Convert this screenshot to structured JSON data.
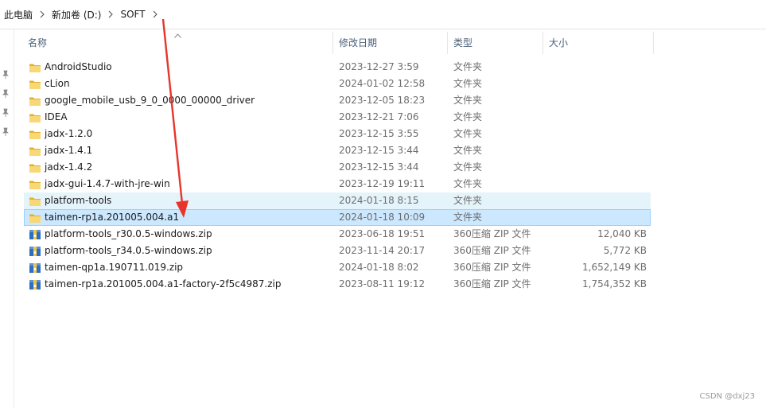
{
  "breadcrumb": {
    "items": [
      "此电脑",
      "新加卷 (D:)",
      "SOFT"
    ]
  },
  "columns": {
    "name": "名称",
    "date": "修改日期",
    "type": "类型",
    "size": "大小"
  },
  "files": [
    {
      "name": "AndroidStudio",
      "date": "2023-12-27 3:59",
      "type": "文件夹",
      "size": "",
      "kind": "folder",
      "state": "normal"
    },
    {
      "name": "cLion",
      "date": "2024-01-02 12:58",
      "type": "文件夹",
      "size": "",
      "kind": "folder",
      "state": "normal"
    },
    {
      "name": "google_mobile_usb_9_0_0000_00000_driver",
      "date": "2023-12-05 18:23",
      "type": "文件夹",
      "size": "",
      "kind": "folder",
      "state": "normal"
    },
    {
      "name": "IDEA",
      "date": "2023-12-21 7:06",
      "type": "文件夹",
      "size": "",
      "kind": "folder",
      "state": "normal"
    },
    {
      "name": "jadx-1.2.0",
      "date": "2023-12-15 3:55",
      "type": "文件夹",
      "size": "",
      "kind": "folder",
      "state": "normal"
    },
    {
      "name": "jadx-1.4.1",
      "date": "2023-12-15 3:44",
      "type": "文件夹",
      "size": "",
      "kind": "folder",
      "state": "normal"
    },
    {
      "name": "jadx-1.4.2",
      "date": "2023-12-15 3:44",
      "type": "文件夹",
      "size": "",
      "kind": "folder",
      "state": "normal"
    },
    {
      "name": "jadx-gui-1.4.7-with-jre-win",
      "date": "2023-12-19 19:11",
      "type": "文件夹",
      "size": "",
      "kind": "folder",
      "state": "normal"
    },
    {
      "name": "platform-tools",
      "date": "2024-01-18 8:15",
      "type": "文件夹",
      "size": "",
      "kind": "folder",
      "state": "hover"
    },
    {
      "name": "taimen-rp1a.201005.004.a1",
      "date": "2024-01-18 10:09",
      "type": "文件夹",
      "size": "",
      "kind": "folder",
      "state": "selected"
    },
    {
      "name": "platform-tools_r30.0.5-windows.zip",
      "date": "2023-06-18 19:51",
      "type": "360压缩 ZIP 文件",
      "size": "12,040 KB",
      "kind": "zip",
      "state": "normal"
    },
    {
      "name": "platform-tools_r34.0.5-windows.zip",
      "date": "2023-11-14 20:17",
      "type": "360压缩 ZIP 文件",
      "size": "5,772 KB",
      "kind": "zip",
      "state": "normal"
    },
    {
      "name": "taimen-qp1a.190711.019.zip",
      "date": "2024-01-18 8:02",
      "type": "360压缩 ZIP 文件",
      "size": "1,652,149 KB",
      "kind": "zip",
      "state": "normal"
    },
    {
      "name": "taimen-rp1a.201005.004.a1-factory-2f5c4987.zip",
      "date": "2023-08-11 19:12",
      "type": "360压缩 ZIP 文件",
      "size": "1,754,352 KB",
      "kind": "zip",
      "state": "normal"
    }
  ],
  "colors": {
    "folder": "#f8d775",
    "folder_dark": "#e0b030",
    "zip_blue": "#2f6fbf",
    "annotation_arrow": "#e8342a",
    "selected_bg": "#cce8ff",
    "selected_border": "#99d1ff",
    "hover_bg": "#e5f3fb"
  },
  "watermark": "CSDN @dxj23"
}
